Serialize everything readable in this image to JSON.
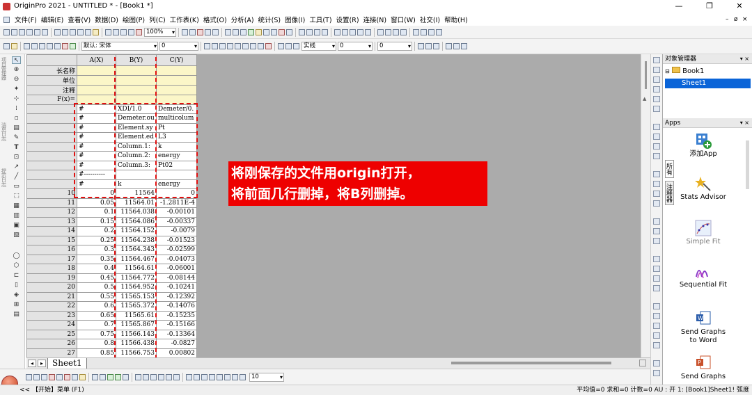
{
  "window": {
    "title": "OriginPro 2021 - UNTITLED * - [Book1 *]",
    "min": "—",
    "restore": "❐",
    "close": "✕"
  },
  "menu": [
    "文件(F)",
    "编辑(E)",
    "查看(V)",
    "数据(D)",
    "绘图(P)",
    "列(C)",
    "工作表(K)",
    "格式(O)",
    "分析(A)",
    "统计(S)",
    "图像(I)",
    "工具(T)",
    "设置(R)",
    "连接(N)",
    "窗口(W)",
    "社交(I)",
    "帮助(H)"
  ],
  "toolbar": {
    "zoom": "100%",
    "font": "默认: 宋体",
    "font_size": "0",
    "line_style": "实线",
    "line_width": "0",
    "size2": "0"
  },
  "left_panels": [
    "项目管理器",
    "消息日志",
    "提示日志"
  ],
  "worksheet": {
    "col_headers": [
      "A(X)",
      "B(Y)",
      "C(Y)"
    ],
    "meta_rows": [
      "长名称",
      "单位",
      "注释",
      "F(x)="
    ],
    "rows": [
      {
        "idx": "",
        "a": "#",
        "b": "XDI/1.0",
        "c": "Demeter/0."
      },
      {
        "idx": "",
        "a": "#",
        "b": "Demeter.ou",
        "c": "multicolum"
      },
      {
        "idx": "",
        "a": "#",
        "b": "Element.sy",
        "c": "Pt"
      },
      {
        "idx": "",
        "a": "#",
        "b": "Element.ed",
        "c": "L3"
      },
      {
        "idx": "",
        "a": "#",
        "b": "Column.1:",
        "c": "k"
      },
      {
        "idx": "",
        "a": "#",
        "b": "Column.2:",
        "c": "energy"
      },
      {
        "idx": "",
        "a": "#",
        "b": "Column.3:",
        "c": "Pt02"
      },
      {
        "idx": "",
        "a": "#----------",
        "b": "",
        "c": ""
      },
      {
        "idx": "",
        "a": "#",
        "b": "k",
        "c": "energy"
      },
      {
        "idx": "10",
        "a": "0",
        "b": "11564",
        "c": "0"
      },
      {
        "idx": "11",
        "a": "0.05",
        "b": "11564.01",
        "c": "-1.2811E-4"
      },
      {
        "idx": "12",
        "a": "0.1",
        "b": "11564.038",
        "c": "-0.00101"
      },
      {
        "idx": "13",
        "a": "0.15",
        "b": "11564.086",
        "c": "-0.00337"
      },
      {
        "idx": "14",
        "a": "0.2",
        "b": "11564.152",
        "c": "-0.0079"
      },
      {
        "idx": "15",
        "a": "0.25",
        "b": "11564.238",
        "c": "-0.01523"
      },
      {
        "idx": "16",
        "a": "0.3",
        "b": "11564.343",
        "c": "-0.02599"
      },
      {
        "idx": "17",
        "a": "0.35",
        "b": "11564.467",
        "c": "-0.04073"
      },
      {
        "idx": "18",
        "a": "0.4",
        "b": "11564.61",
        "c": "-0.06001"
      },
      {
        "idx": "19",
        "a": "0.45",
        "b": "11564.772",
        "c": "-0.08144"
      },
      {
        "idx": "20",
        "a": "0.5",
        "b": "11564.952",
        "c": "-0.10241"
      },
      {
        "idx": "21",
        "a": "0.55",
        "b": "11565.153",
        "c": "-0.12392"
      },
      {
        "idx": "22",
        "a": "0.6",
        "b": "11565.372",
        "c": "-0.14076"
      },
      {
        "idx": "23",
        "a": "0.65",
        "b": "11565.61",
        "c": "-0.15235"
      },
      {
        "idx": "24",
        "a": "0.7",
        "b": "11565.867",
        "c": "-0.15166"
      },
      {
        "idx": "25",
        "a": "0.75",
        "b": "11566.143",
        "c": "-0.13364"
      },
      {
        "idx": "26",
        "a": "0.8",
        "b": "11566.438",
        "c": "-0.0827"
      },
      {
        "idx": "27",
        "a": "0.85",
        "b": "11566.753",
        "c": "0.00802"
      }
    ],
    "sheet_tab": "Sheet1"
  },
  "callout": {
    "line1": "将刚保存的文件用origin打开，",
    "line2": "将前面几行删掉，将B列删掉。"
  },
  "object_manager": {
    "title": "对象管理器",
    "book": "Book1",
    "sheet": "Sheet1"
  },
  "apps": {
    "title": "Apps",
    "tabs": [
      "所有",
      "注释器"
    ],
    "items": [
      "添加App",
      "Stats Advisor",
      "Simple Fit",
      "Sequential Fit",
      "Send Graphs to Word",
      "Send Graphs"
    ]
  },
  "statusbar": {
    "left": "<< 【开始】菜单 (F1)",
    "right": "平均值=0 求和=0 计数=0   AU : 开   1: [Book1]Sheet1!  弧度"
  },
  "bottom_combo": "10",
  "colors": {
    "accent_select": "#0a64d8",
    "callout_bg": "#ee0000",
    "dash": "#e01010",
    "meta_bg": "#fbf6c8"
  }
}
